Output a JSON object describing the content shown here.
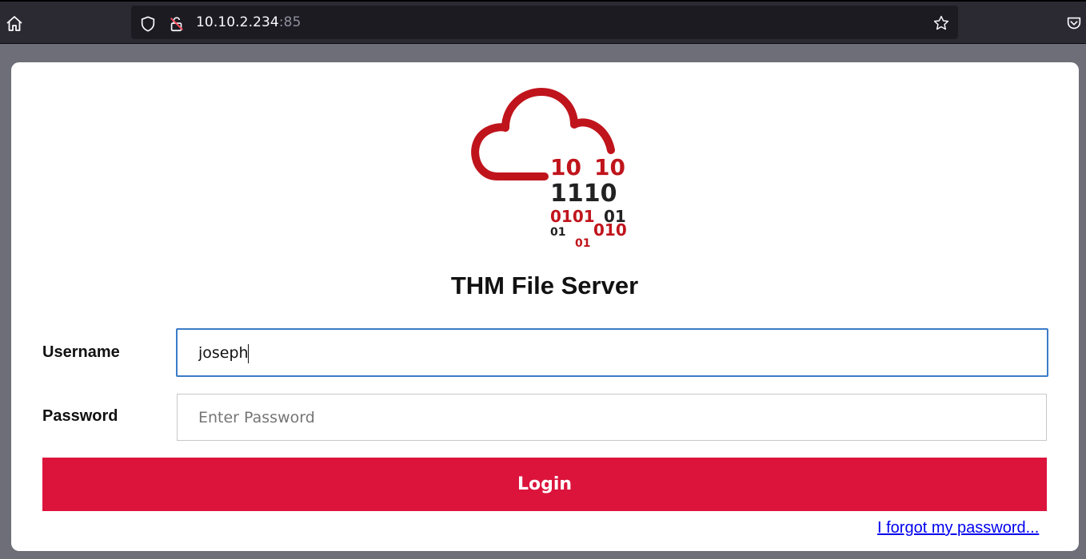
{
  "browser": {
    "url_host": "10.10.2.234",
    "url_port": ":85",
    "icons": [
      "home-icon",
      "shield-icon",
      "insecure-lock-icon",
      "star-icon",
      "pocket-icon"
    ]
  },
  "login": {
    "logo_digits": {
      "row1a": "10",
      "row1b": "10",
      "row2": "1110",
      "row3a": "0101",
      "row3b": "01",
      "row4a": "01",
      "row4b": "010",
      "row5": "01"
    },
    "title": "THM File Server",
    "username_label": "Username",
    "username_value": "joseph",
    "password_label": "Password",
    "password_placeholder": "Enter Password",
    "login_label": "Login",
    "forgot_label": "I forgot my password..."
  },
  "colors": {
    "accent": "#dc143c",
    "logo_red": "#c0141c",
    "focus_border": "#3b7bc8",
    "link": "#0000ee"
  }
}
